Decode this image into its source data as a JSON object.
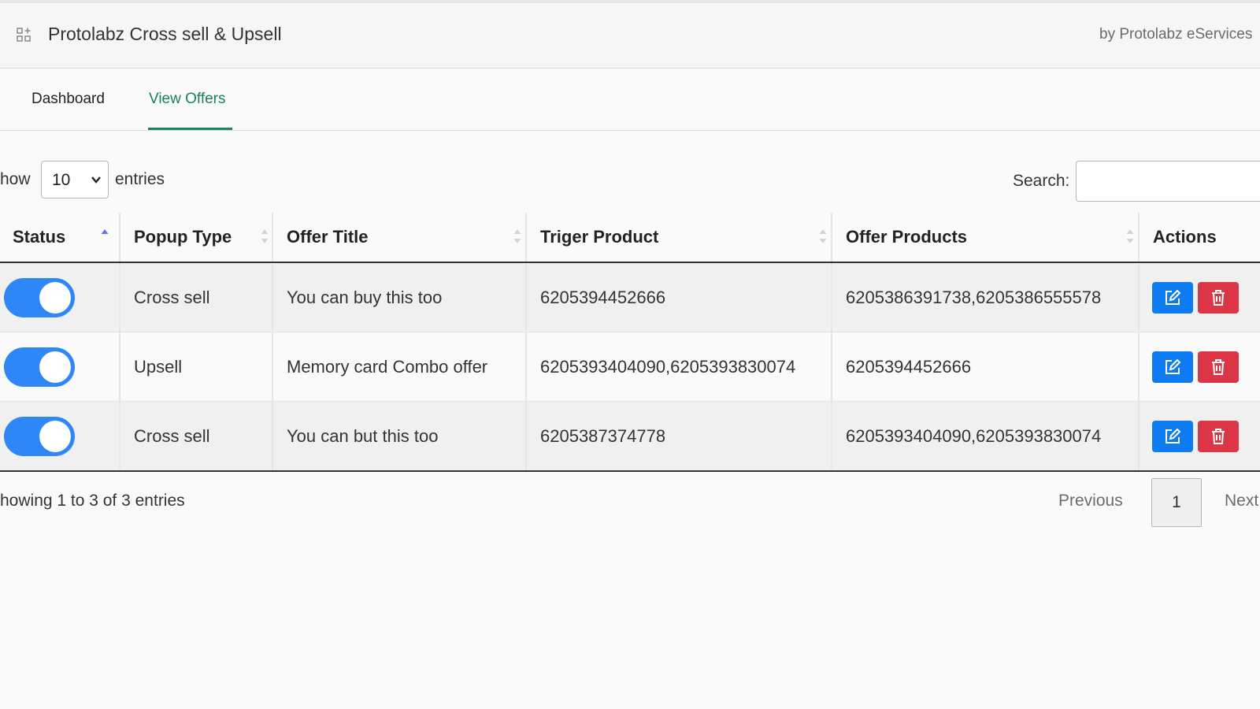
{
  "app": {
    "title": "Protolabz Cross sell & Upsell",
    "byline": "by Protolabz eServices"
  },
  "tabs": [
    {
      "label": "Dashboard",
      "active": false
    },
    {
      "label": "View Offers",
      "active": true
    }
  ],
  "controls": {
    "show_label": "how",
    "entries_value": "10",
    "entries_label": "entries",
    "search_label": "Search:",
    "search_value": ""
  },
  "table": {
    "columns": [
      "Status",
      "Popup Type",
      "Offer Title",
      "Triger Product",
      "Offer Products",
      "Actions"
    ],
    "rows": [
      {
        "status_on": true,
        "popup_type": "Cross sell",
        "offer_title": "You can buy this too",
        "trigger_product": "6205394452666",
        "offer_products": "6205386391738,6205386555578"
      },
      {
        "status_on": true,
        "popup_type": "Upsell",
        "offer_title": "Memory card Combo offer",
        "trigger_product": "6205393404090,6205393830074",
        "offer_products": "6205394452666"
      },
      {
        "status_on": true,
        "popup_type": "Cross sell",
        "offer_title": "You can but this too",
        "trigger_product": "6205387374778",
        "offer_products": "6205393404090,6205393830074"
      }
    ]
  },
  "footer": {
    "info": "howing 1 to 3 of 3 entries",
    "previous": "Previous",
    "page": "1",
    "next": "Next"
  },
  "colors": {
    "accent": "#1a7f64",
    "toggle_on": "#2f86f6",
    "edit_button": "#0d7cf2",
    "delete_button": "#dc3545"
  },
  "icons": [
    "apps-grid-icon",
    "chevron-down-icon",
    "sort-asc-icon",
    "sort-both-icon",
    "edit-icon",
    "trash-icon"
  ]
}
